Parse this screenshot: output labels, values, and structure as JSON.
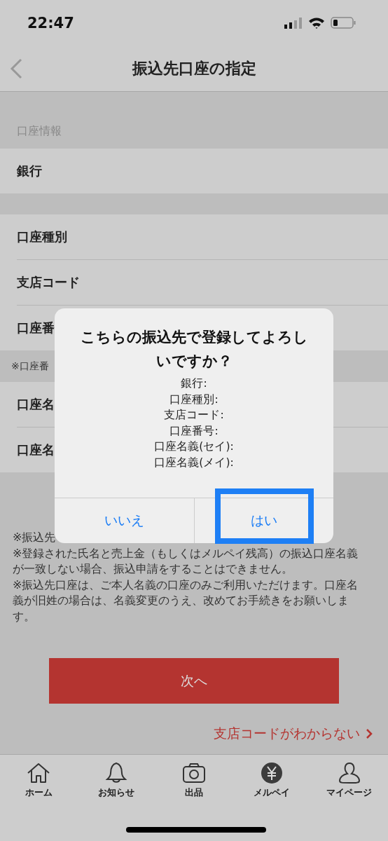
{
  "status_bar": {
    "time": "22:47"
  },
  "nav": {
    "title": "振込先口座の指定"
  },
  "section_header": "口座情報",
  "groups": [
    {
      "rows": [
        "銀行"
      ]
    },
    {
      "rows": [
        "口座種別",
        "支店コード",
        "口座番"
      ],
      "note": "※口座番"
    },
    {
      "rows": [
        "口座名",
        "口座名"
      ]
    }
  ],
  "notes": [
    "※振込先",
    "※登録された氏名と売上金（もしくはメルペイ残高）の振込口座名義が一致しない場合、振込申請をすることはできません。",
    "※振込先口座は、ご本人名義の口座のみご利用いただけます。口座名義が旧姓の場合は、名義変更のうえ、改めてお手続きをお願いします。"
  ],
  "next_button": "次へ",
  "branch_code_link": "支店コードがわからない",
  "dialog": {
    "title": "こちらの振込先で登録してよろしいですか？",
    "lines": [
      "銀行:",
      "口座種別:",
      "支店コード:",
      "口座番号:",
      "口座名義(セイ):",
      "口座名義(メイ):"
    ],
    "buttons": [
      {
        "label": "いいえ",
        "highlighted": false
      },
      {
        "label": "はい",
        "highlighted": true
      }
    ]
  },
  "tab_bar": [
    {
      "kind": "home",
      "label": "ホーム"
    },
    {
      "kind": "bell",
      "label": "お知らせ"
    },
    {
      "kind": "camera",
      "label": "出品"
    },
    {
      "kind": "yen",
      "label": "メルペイ"
    },
    {
      "kind": "person",
      "label": "マイページ"
    }
  ]
}
